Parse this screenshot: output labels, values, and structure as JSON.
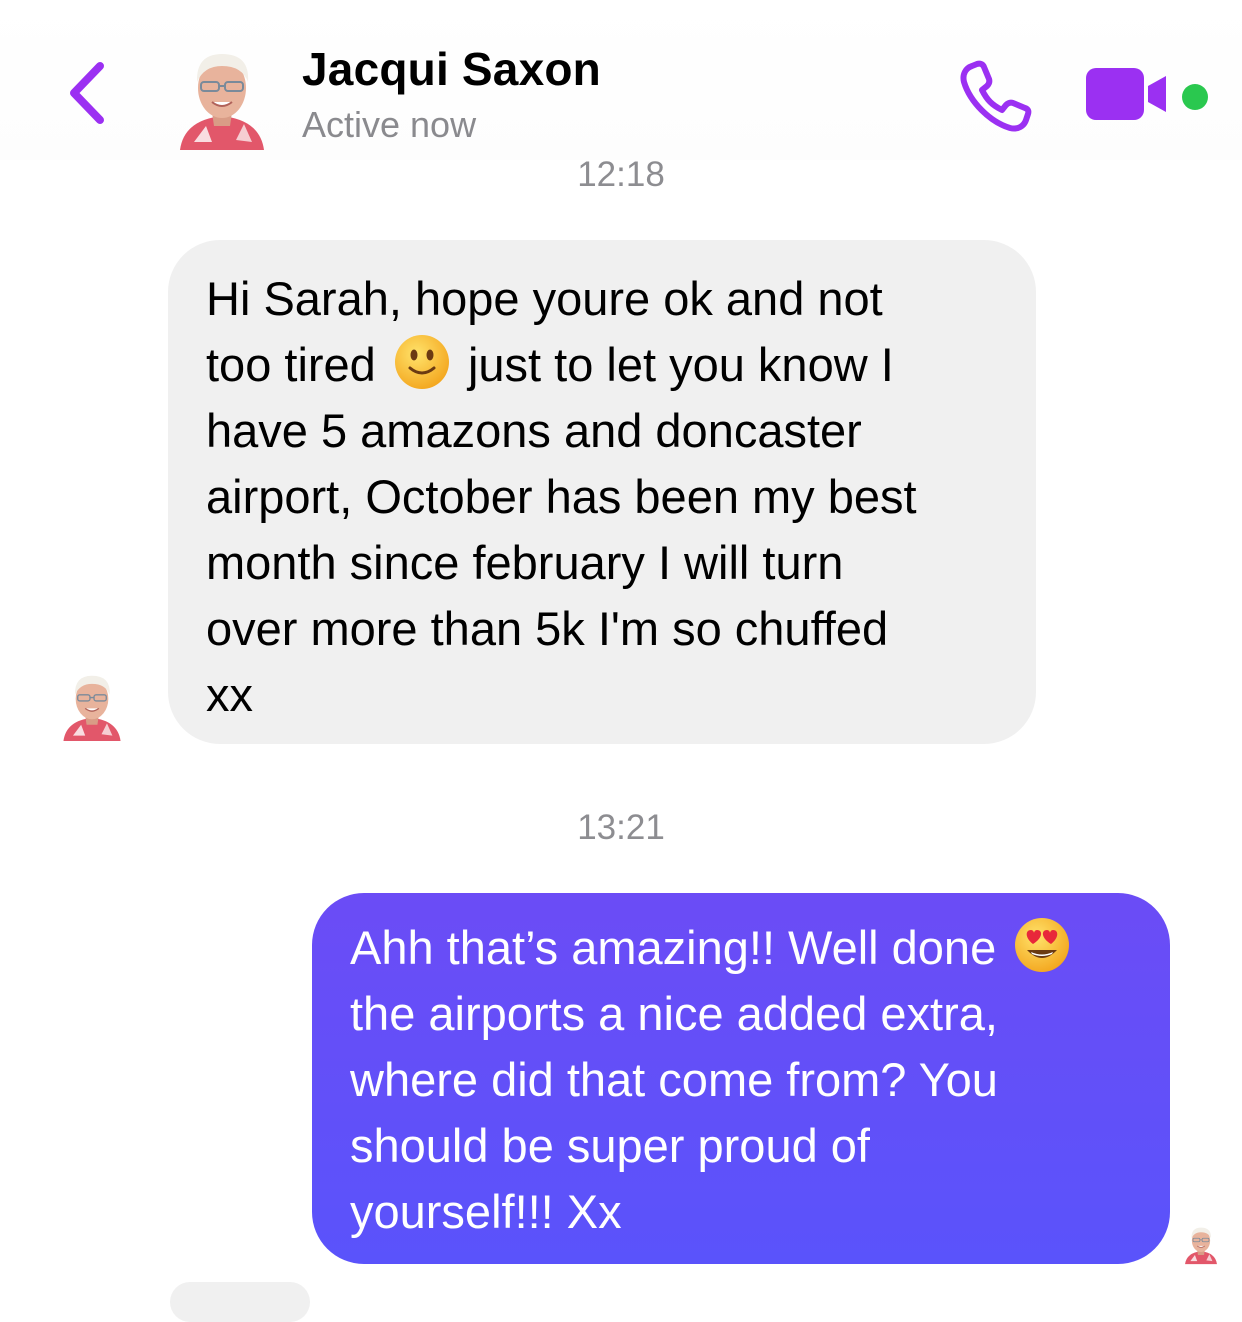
{
  "header": {
    "contact_name": "Jacqui Saxon",
    "status": "Active now",
    "accent_color": "#9b30f2",
    "icons": [
      "chevron-left-icon",
      "phone-icon",
      "video-camera-icon",
      "online-dot-icon"
    ]
  },
  "messages": [
    {
      "timestamp": "12:18",
      "direction": "incoming",
      "text_before_emoji": "Hi Sarah, hope youre ok and not\ntoo tired ",
      "emoji": "slightly-smiling-face",
      "text_after_emoji": " just to let you know I\nhave 5 amazons and doncaster\nairport, October has been my best\nmonth since february I will turn\nover more than 5k I'm so chuffed\nxx"
    },
    {
      "timestamp": "13:21",
      "direction": "outgoing",
      "text_before_emoji": "Ahh that’s amazing!! Well done ",
      "emoji": "heart-eyes",
      "text_after_emoji": "\nthe airports a nice added extra,\nwhere did that come from? You\nshould be super proud of\nyourself!!! Xx"
    }
  ],
  "colors": {
    "incoming_bubble": "#f0f0f0",
    "outgoing_bubble_top": "#6b4cf6",
    "outgoing_bubble_bottom": "#5a53fb",
    "timestamp": "#8d8d91",
    "online": "#2ac84f"
  }
}
